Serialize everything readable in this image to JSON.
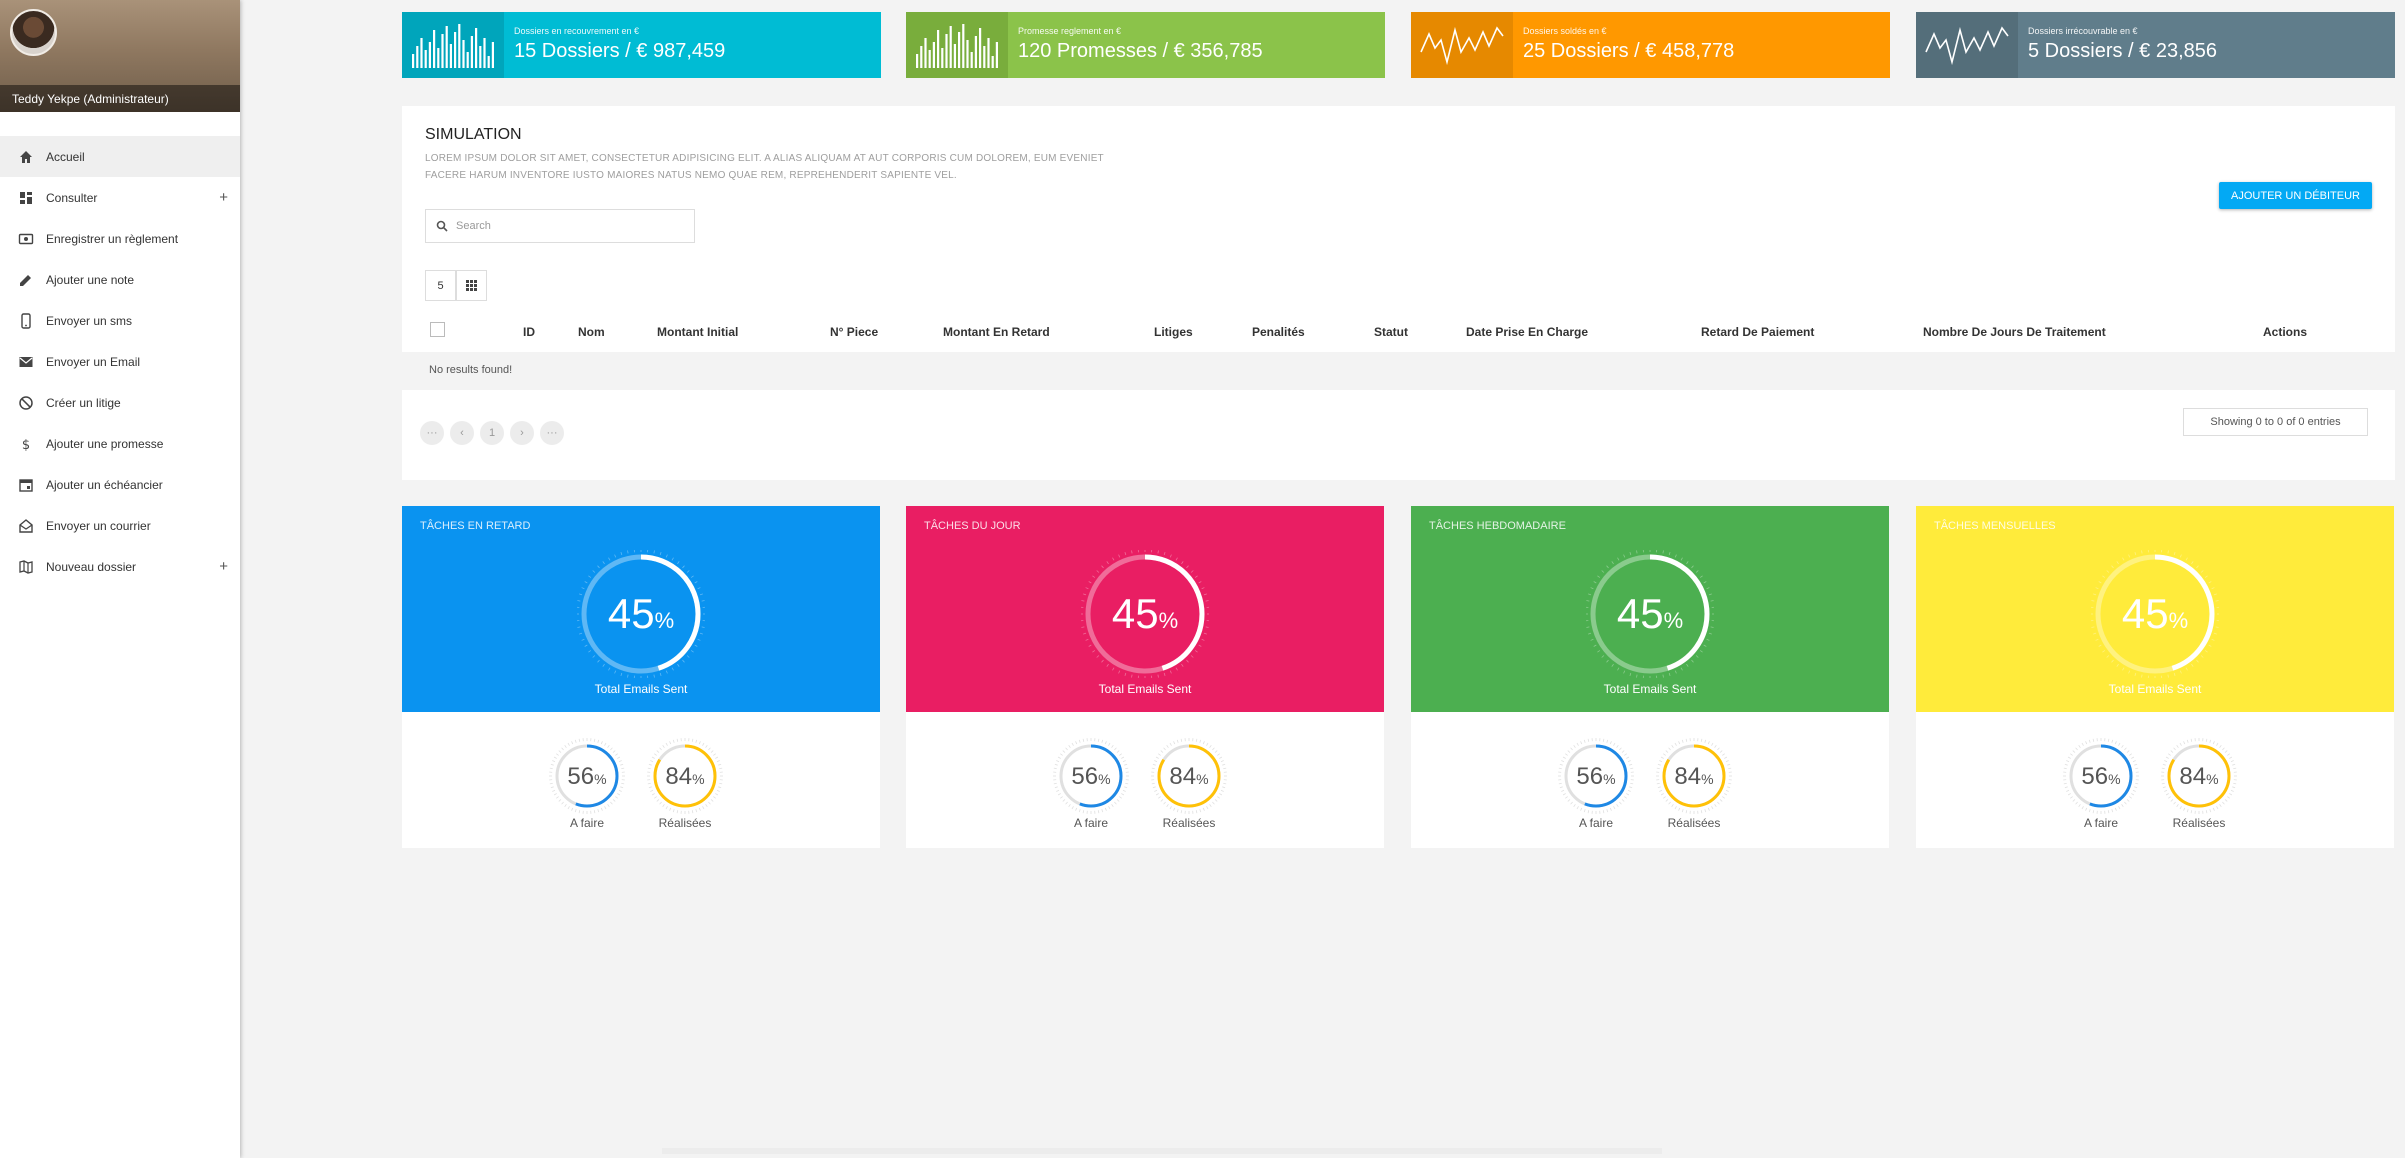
{
  "profile": {
    "name": "Teddy Yekpe (Administrateur)"
  },
  "menu": [
    {
      "label": "Accueil",
      "icon": "home-icon",
      "active": true,
      "plus": false
    },
    {
      "label": "Consulter",
      "icon": "dashboard-icon",
      "active": false,
      "plus": true
    },
    {
      "label": "Enregistrer un règlement",
      "icon": "money-icon",
      "active": false,
      "plus": false
    },
    {
      "label": "Ajouter une note",
      "icon": "pencil-icon",
      "active": false,
      "plus": false
    },
    {
      "label": "Envoyer un sms",
      "icon": "phone-icon",
      "active": false,
      "plus": false
    },
    {
      "label": "Envoyer un Email",
      "icon": "mail-icon",
      "active": false,
      "plus": false
    },
    {
      "label": "Créer un litige",
      "icon": "block-icon",
      "active": false,
      "plus": false
    },
    {
      "label": "Ajouter une promesse",
      "icon": "dollar-icon",
      "active": false,
      "plus": false
    },
    {
      "label": "Ajouter un échéancier",
      "icon": "calendar-icon",
      "active": false,
      "plus": false
    },
    {
      "label": "Envoyer un courrier",
      "icon": "letter-icon",
      "active": false,
      "plus": false
    },
    {
      "label": "Nouveau dossier",
      "icon": "map-icon",
      "active": false,
      "plus": true
    }
  ],
  "menu_plus": "+",
  "stats": [
    {
      "label": "Dossiers en recouvrement en €",
      "value": "15 Dossiers / € 987,459",
      "color": "#00bcd4",
      "dark": "#00a5bb",
      "chart": "bar"
    },
    {
      "label": "Promesse reglement en €",
      "value": "120 Promesses / € 356,785",
      "color": "#8bc34a",
      "dark": "#79ad3c",
      "chart": "bar"
    },
    {
      "label": "Dossiers soldés en €",
      "value": "25 Dossiers / € 458,778",
      "color": "#ff9800",
      "dark": "#e68900",
      "chart": "line"
    },
    {
      "label": "Dossiers irrécouvrable en €",
      "value": "5 Dossiers / € 23,856",
      "color": "#607d8b",
      "dark": "#546e7a",
      "chart": "line"
    }
  ],
  "simulation": {
    "title": "SIMULATION",
    "description": "LOREM IPSUM DOLOR SIT AMET, CONSECTETUR ADIPISICING ELIT. A ALIAS ALIQUAM AT AUT CORPORIS CUM DOLOREM, EUM EVENIET FACERE HARUM INVENTORE IUSTO MAIORES NATUS NEMO QUAE REM, REPREHENDERIT SAPIENTE VEL.",
    "add_button": "AJOUTER UN DÉBITEUR",
    "search_placeholder": "Search",
    "page_size": "5",
    "columns": [
      "ID",
      "Nom",
      "Montant Initial",
      "N° Piece",
      "Montant En Retard",
      "Litiges",
      "Penalités",
      "Statut",
      "Date Prise En Charge",
      "Retard De Paiement",
      "Nombre De Jours De Traitement",
      "Actions"
    ],
    "no_results": "No results found!",
    "pagination": [
      "···",
      "‹",
      "1",
      "›",
      "···"
    ],
    "showing": "Showing 0 to 0 of 0 entries"
  },
  "tasks": [
    {
      "title": "Tâches en retard",
      "color": "#0a93f0",
      "percent": 45,
      "caption": "Total Emails Sent",
      "a_faire": 56,
      "realisees": 84
    },
    {
      "title": "Tâches du jour",
      "color": "#e91e63",
      "percent": 45,
      "caption": "Total Emails Sent",
      "a_faire": 56,
      "realisees": 84
    },
    {
      "title": "Tâches hebdomadaire",
      "color": "#4caf50",
      "percent": 45,
      "caption": "Total Emails Sent",
      "a_faire": 56,
      "realisees": 84
    },
    {
      "title": "Tâches mensuelles",
      "color": "#ffeb3b",
      "percent": 45,
      "caption": "Total Emails Sent",
      "a_faire": 56,
      "realisees": 84
    }
  ],
  "task_labels": {
    "a_faire": "A faire",
    "realisees": "Réalisées",
    "percent_sign": "%"
  },
  "colors": {
    "mini_blue": "#1e88e5",
    "mini_orange": "#ffc107",
    "accent": "#03a9f4"
  }
}
